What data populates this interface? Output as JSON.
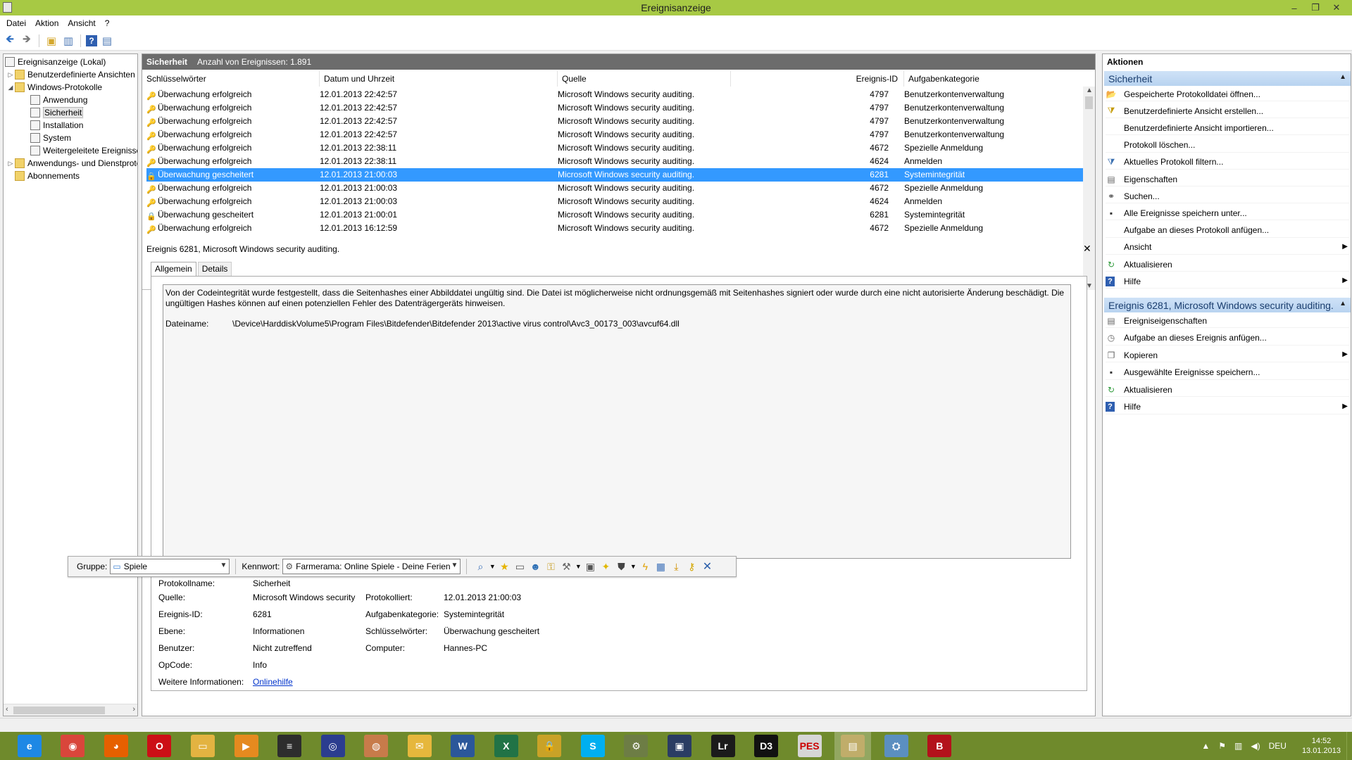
{
  "window": {
    "title": "Ereignisanzeige"
  },
  "menu": [
    "Datei",
    "Aktion",
    "Ansicht",
    "?"
  ],
  "tree": [
    {
      "label": "Ereignisanzeige (Lokal)"
    },
    {
      "label": "Benutzerdefinierte Ansichten"
    },
    {
      "label": "Windows-Protokolle"
    },
    {
      "label": "Anwendung"
    },
    {
      "label": "Sicherheit"
    },
    {
      "label": "Installation"
    },
    {
      "label": "System"
    },
    {
      "label": "Weitergeleitete Ereignisse"
    },
    {
      "label": "Anwendungs- und Dienstprotokolle"
    },
    {
      "label": "Abonnements"
    }
  ],
  "center": {
    "log_name": "Sicherheit",
    "count_text": "Anzahl von Ereignissen: 1.891"
  },
  "columns": [
    "Schlüsselwörter",
    "Datum und Uhrzeit",
    "Quelle",
    "Ereignis-ID",
    "Aufgabenkategorie"
  ],
  "events": [
    {
      "keyword": "Überwachung erfolgreich",
      "date": "12.01.2013 22:42:57",
      "source": "Microsoft Windows security auditing.",
      "id": "4797",
      "category": "Benutzerkontenverwaltung",
      "type": "success"
    },
    {
      "keyword": "Überwachung erfolgreich",
      "date": "12.01.2013 22:42:57",
      "source": "Microsoft Windows security auditing.",
      "id": "4797",
      "category": "Benutzerkontenverwaltung",
      "type": "success"
    },
    {
      "keyword": "Überwachung erfolgreich",
      "date": "12.01.2013 22:42:57",
      "source": "Microsoft Windows security auditing.",
      "id": "4797",
      "category": "Benutzerkontenverwaltung",
      "type": "success"
    },
    {
      "keyword": "Überwachung erfolgreich",
      "date": "12.01.2013 22:42:57",
      "source": "Microsoft Windows security auditing.",
      "id": "4797",
      "category": "Benutzerkontenverwaltung",
      "type": "success"
    },
    {
      "keyword": "Überwachung erfolgreich",
      "date": "12.01.2013 22:38:11",
      "source": "Microsoft Windows security auditing.",
      "id": "4672",
      "category": "Spezielle Anmeldung",
      "type": "success"
    },
    {
      "keyword": "Überwachung erfolgreich",
      "date": "12.01.2013 22:38:11",
      "source": "Microsoft Windows security auditing.",
      "id": "4624",
      "category": "Anmelden",
      "type": "success"
    },
    {
      "keyword": "Überwachung gescheitert",
      "date": "12.01.2013 21:00:03",
      "source": "Microsoft Windows security auditing.",
      "id": "6281",
      "category": "Systemintegrität",
      "type": "failure"
    },
    {
      "keyword": "Überwachung erfolgreich",
      "date": "12.01.2013 21:00:03",
      "source": "Microsoft Windows security auditing.",
      "id": "4672",
      "category": "Spezielle Anmeldung",
      "type": "success"
    },
    {
      "keyword": "Überwachung erfolgreich",
      "date": "12.01.2013 21:00:03",
      "source": "Microsoft Windows security auditing.",
      "id": "4624",
      "category": "Anmelden",
      "type": "success"
    },
    {
      "keyword": "Überwachung gescheitert",
      "date": "12.01.2013 21:00:01",
      "source": "Microsoft Windows security auditing.",
      "id": "6281",
      "category": "Systemintegrität",
      "type": "failure"
    },
    {
      "keyword": "Überwachung erfolgreich",
      "date": "12.01.2013 16:12:59",
      "source": "Microsoft Windows security auditing.",
      "id": "4672",
      "category": "Spezielle Anmeldung",
      "type": "success"
    }
  ],
  "selected_event_index": 6,
  "detail": {
    "title": "Ereignis 6281, Microsoft Windows security auditing.",
    "tabs": [
      "Allgemein",
      "Details"
    ],
    "message": "Von der Codeintegrität wurde festgestellt, dass die Seitenhashes einer Abbilddatei ungültig sind. Die Datei ist möglicherweise nicht ordnungsgemäß mit Seitenhashes signiert oder wurde durch eine nicht autorisierte Änderung beschädigt. Die ungültigen Hashes können auf einen potenziellen Fehler des Datenträgergeräts hinweisen.",
    "file_label": "Dateiname:",
    "file_value": "\\Device\\HarddiskVolume5\\Program Files\\Bitdefender\\Bitdefender 2013\\active virus control\\Avc3_00173_003\\avcuf64.dll",
    "props": {
      "protokollname_label": "Protokollname:",
      "protokollname": "Sicherheit",
      "quelle_label": "Quelle:",
      "quelle": "Microsoft Windows security",
      "protokolliert_label": "Protokolliert:",
      "protokolliert": "12.01.2013 21:00:03",
      "ereignis_id_label": "Ereignis-ID:",
      "ereignis_id": "6281",
      "aufgabenkategorie_label": "Aufgabenkategorie:",
      "aufgabenkategorie": "Systemintegrität",
      "ebene_label": "Ebene:",
      "ebene": "Informationen",
      "schluesselwoerter_label": "Schlüsselwörter:",
      "schluesselwoerter": "Überwachung gescheitert",
      "benutzer_label": "Benutzer:",
      "benutzer": "Nicht zutreffend",
      "computer_label": "Computer:",
      "computer": "Hannes-PC",
      "opcode_label": "OpCode:",
      "opcode": "Info",
      "weitere_label": "Weitere Informationen:",
      "weitere_link": "Onlinehilfe"
    }
  },
  "floatbar": {
    "group_label": "Gruppe:",
    "group_value": "Spiele",
    "password_label": "Kennwort:",
    "password_value": "Farmerama: Online Spiele - Deine Ferien"
  },
  "actions": {
    "title": "Aktionen",
    "section1": "Sicherheit",
    "items1": [
      {
        "label": "Gespeicherte Protokolldatei öffnen...",
        "icon": "open-folder-icon"
      },
      {
        "label": "Benutzerdefinierte Ansicht erstellen...",
        "icon": "filter-create-icon"
      },
      {
        "label": "Benutzerdefinierte Ansicht importieren...",
        "icon": "none"
      },
      {
        "label": "Protokoll löschen...",
        "icon": "none"
      },
      {
        "label": "Aktuelles Protokoll filtern...",
        "icon": "filter-icon"
      },
      {
        "label": "Eigenschaften",
        "icon": "properties-icon"
      },
      {
        "label": "Suchen...",
        "icon": "find-icon"
      },
      {
        "label": "Alle Ereignisse speichern unter...",
        "icon": "save-icon"
      },
      {
        "label": "Aufgabe an dieses Protokoll anfügen...",
        "icon": "none"
      },
      {
        "label": "Ansicht",
        "icon": "none",
        "submenu": true
      },
      {
        "label": "Aktualisieren",
        "icon": "refresh-icon"
      },
      {
        "label": "Hilfe",
        "icon": "help-icon",
        "submenu": true
      }
    ],
    "section2": "Ereignis 6281, Microsoft Windows security auditing.",
    "items2": [
      {
        "label": "Ereigniseigenschaften",
        "icon": "event-properties-icon"
      },
      {
        "label": "Aufgabe an dieses Ereignis anfügen...",
        "icon": "task-icon"
      },
      {
        "label": "Kopieren",
        "icon": "copy-icon",
        "submenu": true
      },
      {
        "label": "Ausgewählte Ereignisse speichern...",
        "icon": "save-icon"
      },
      {
        "label": "Aktualisieren",
        "icon": "refresh-icon"
      },
      {
        "label": "Hilfe",
        "icon": "help-icon",
        "submenu": true
      }
    ]
  },
  "taskbar": {
    "apps": [
      {
        "name": "internet-explorer",
        "color": "#1e88e5",
        "glyph": "e"
      },
      {
        "name": "chrome",
        "color": "#d9463b",
        "glyph": "◉"
      },
      {
        "name": "firefox",
        "color": "#e66000",
        "glyph": "◕"
      },
      {
        "name": "opera",
        "color": "#cc0f16",
        "glyph": "O"
      },
      {
        "name": "explorer",
        "color": "#e3b341",
        "glyph": "▭"
      },
      {
        "name": "media-player",
        "color": "#e58a1f",
        "glyph": "▶"
      },
      {
        "name": "equalizer",
        "color": "#2d2d2d",
        "glyph": "≡"
      },
      {
        "name": "media-center",
        "color": "#2b3d8f",
        "glyph": "◎"
      },
      {
        "name": "app-round",
        "color": "#c77b4a",
        "glyph": "◍"
      },
      {
        "name": "app-folder",
        "color": "#e6b73c",
        "glyph": "✉"
      },
      {
        "name": "word",
        "color": "#2b579a",
        "glyph": "W"
      },
      {
        "name": "excel",
        "color": "#217346",
        "glyph": "X"
      },
      {
        "name": "lock-app",
        "color": "#c9a227",
        "glyph": "🔒"
      },
      {
        "name": "skype",
        "color": "#00aff0",
        "glyph": "S"
      },
      {
        "name": "app-tools",
        "color": "#6d7d45",
        "glyph": "⚙"
      },
      {
        "name": "app-photo",
        "color": "#2a3c63",
        "glyph": "▣"
      },
      {
        "name": "lightroom",
        "color": "#1b1b1b",
        "glyph": "Lr"
      },
      {
        "name": "app-d3",
        "color": "#111111",
        "glyph": "D3"
      },
      {
        "name": "pes",
        "color": "#d6d6d6",
        "glyph": "PES"
      },
      {
        "name": "event-viewer",
        "color": "#c0ad6a",
        "glyph": "▤"
      },
      {
        "name": "network-app",
        "color": "#5b8fc0",
        "glyph": "⛭"
      },
      {
        "name": "bitdefender",
        "color": "#b3121b",
        "glyph": "B"
      }
    ],
    "lang": "DEU",
    "time": "14:52",
    "date": "13.01.2013"
  }
}
